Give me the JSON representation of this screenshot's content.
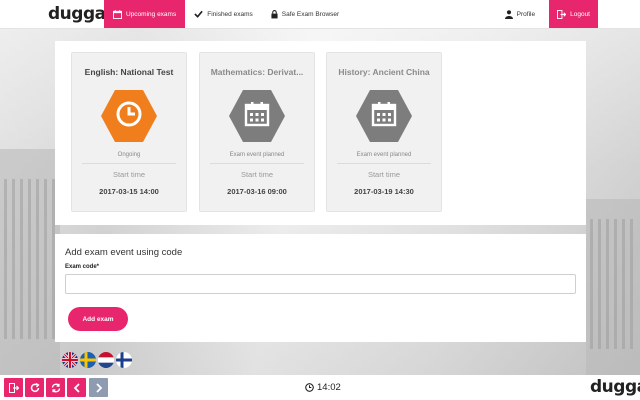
{
  "brand": {
    "logo_text": "dugga"
  },
  "nav": {
    "items": [
      {
        "label": "Upcoming exams",
        "icon": "calendar-icon",
        "active": true
      },
      {
        "label": "Finished exams",
        "icon": "checkmark-icon",
        "active": false
      },
      {
        "label": "Safe Exam Browser",
        "icon": "lock-icon",
        "active": false
      }
    ],
    "profile_label": "Profile",
    "logout_label": "Logout"
  },
  "exams": [
    {
      "title": "English: National Test",
      "icon": "clock-icon",
      "color": "#f07e1c",
      "status": "Ongoing",
      "start_label": "Start time",
      "start_time": "2017-03-15 14:00"
    },
    {
      "title": "Mathematics: Derivat...",
      "icon": "calendar-icon",
      "color": "#7d7d7d",
      "status": "Exam event planned",
      "start_label": "Start time",
      "start_time": "2017-03-16 09:00"
    },
    {
      "title": "History: Ancient China",
      "icon": "calendar-icon",
      "color": "#7d7d7d",
      "status": "Exam event planned",
      "start_label": "Start time",
      "start_time": "2017-03-19 14:30"
    }
  ],
  "add_exam": {
    "title": "Add exam event using code",
    "code_label": "Exam code*",
    "code_value": "",
    "button_label": "Add exam"
  },
  "languages": [
    "uk-flag-icon",
    "sweden-flag-icon",
    "netherlands-flag-icon",
    "finland-flag-icon"
  ],
  "bottom_bar": {
    "buttons": [
      "exit-icon",
      "reload-icon",
      "refresh-icon",
      "back-icon",
      "forward-icon"
    ],
    "clock": "14:02",
    "logo_text": "dugga"
  },
  "colors": {
    "accent": "#e8266d",
    "ongoing": "#f07e1c",
    "planned": "#7d7d7d",
    "nav_grey": "#8e9bb0"
  }
}
